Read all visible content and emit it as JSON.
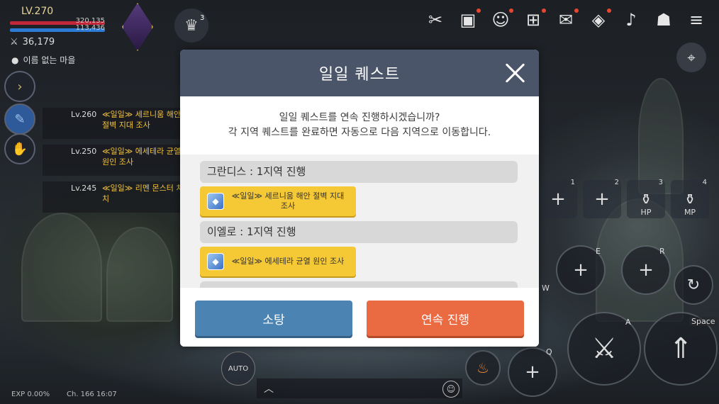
{
  "hud": {
    "level": "LV.270",
    "hp": "320,135",
    "mp": "113,436",
    "power": "36,179",
    "location": "이름 없는 마을",
    "guild_badge": "3"
  },
  "quest_tracker": [
    {
      "level": "Lv.260",
      "title": "≪일일≫ 세르니움 해안 절벽 지대 조사"
    },
    {
      "level": "Lv.250",
      "title": "≪일일≫ 에세테라 균열 원인 조사"
    },
    {
      "level": "Lv.245",
      "title": "≪일일≫ 리멘 몬스터 처치"
    }
  ],
  "skill_slots": [
    {
      "num": "1",
      "label": ""
    },
    {
      "num": "2",
      "label": ""
    },
    {
      "num": "3",
      "label": "HP"
    },
    {
      "num": "4",
      "label": "MP"
    }
  ],
  "skill_keys": {
    "e": "E",
    "r": "R",
    "w": "W",
    "a": "A",
    "q": "Q",
    "space": "Space"
  },
  "bottom": {
    "auto": "AUTO",
    "exp": "EXP 0.00%",
    "channel_time": "Ch. 166  16:07"
  },
  "dialog": {
    "title": "일일 퀘스트",
    "message_line1": "일일 퀘스트를 연속 진행하시겠습니까?",
    "message_line2": "각 지역 퀘스트를 완료하면 자동으로 다음 지역으로 이동합니다.",
    "regions": [
      {
        "name": "그란디스 : 1지역 진행",
        "quest": "≪일일≫ 세르니움 해안 절벽 지대 조사"
      },
      {
        "name": "이엘로 : 1지역 진행",
        "quest": "≪일일≫ 에세테라 균열 원인 조사"
      }
    ],
    "sweep_label": "소탕",
    "continue_label": "연속 진행"
  },
  "colors": {
    "dialog_header": "#4b556a",
    "sweep_button": "#4b83b2",
    "continue_button": "#ea6a42",
    "quest_button": "#f5c836"
  }
}
